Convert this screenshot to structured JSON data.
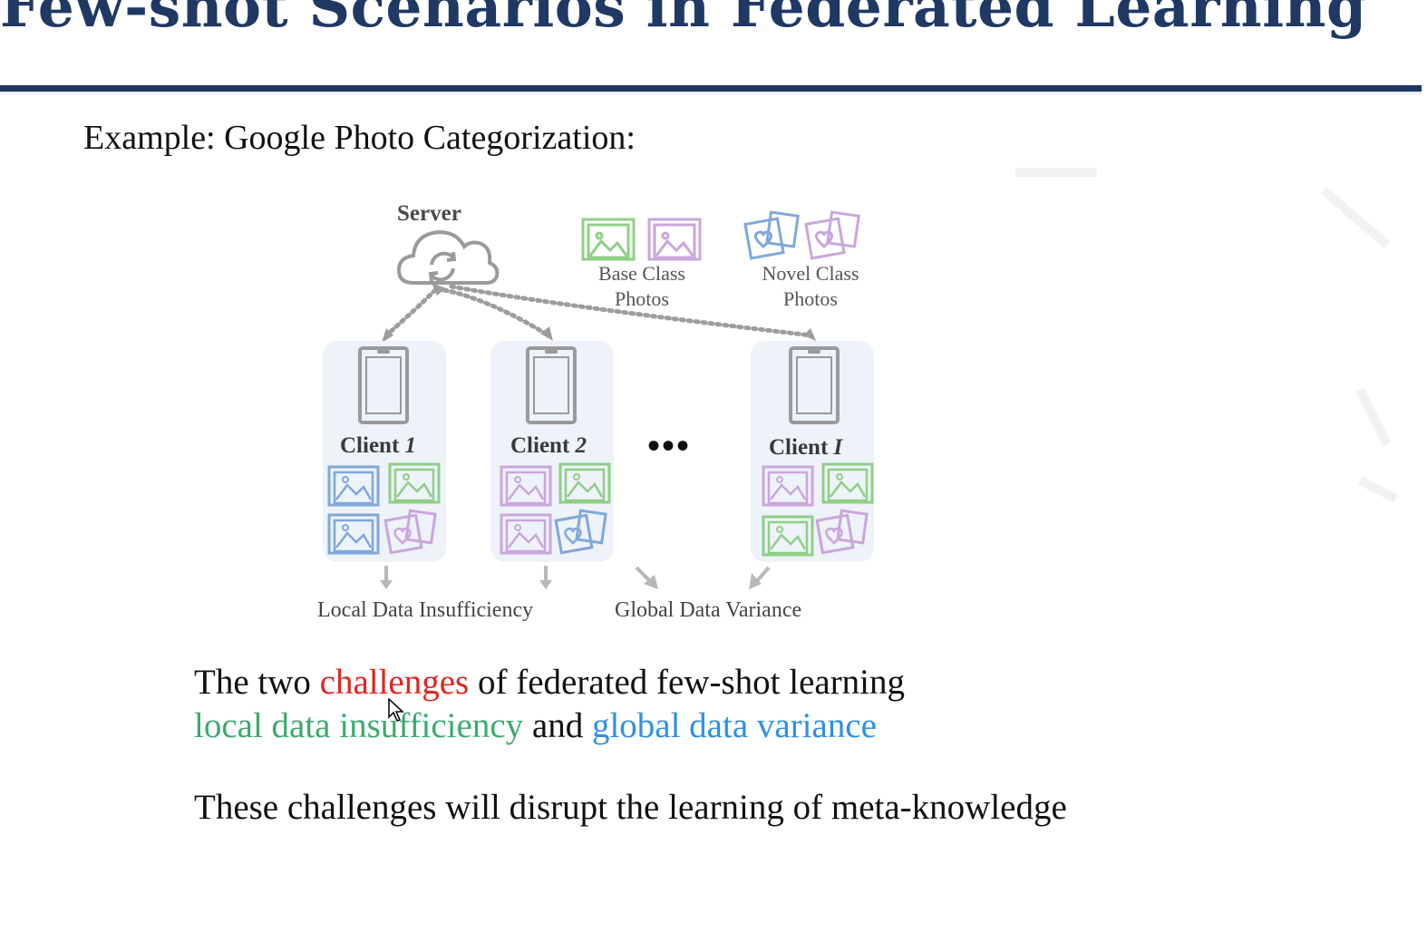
{
  "slide": {
    "title": "Few-shot Scenarios in Federated Learning",
    "subtitle": "Example: Google Photo Categorization:"
  },
  "figure": {
    "server_label": "Server",
    "base_class_line1": "Base Class",
    "base_class_line2": "Photos",
    "novel_class_line1": "Novel Class",
    "novel_class_line2": "Photos",
    "clients": [
      {
        "name": "Client",
        "index": "1"
      },
      {
        "name": "Client",
        "index": "2"
      },
      {
        "name": "Client",
        "index": "I"
      }
    ],
    "ellipsis": "•••",
    "local_label": "Local Data Insufficiency",
    "global_label": "Global Data Variance",
    "colors": {
      "base_green": "#8fcf85",
      "base_purple": "#c9a6dd",
      "novel_blue": "#7fa8d8",
      "card": "#eef2f9",
      "line": "#9a9a9a"
    }
  },
  "text": {
    "line1_pre": "The two ",
    "line1_highlight": "challenges",
    "line1_post": " of federated few-shot learning",
    "line2_green": "local data insufficiency",
    "line2_mid": " and ",
    "line2_blue": "global data variance",
    "line3": "These challenges will disrupt the learning of meta-knowledge"
  },
  "colors": {
    "title": "#1f3864",
    "challenge_red": "#e3241e",
    "local_green": "#3daa6e",
    "global_blue": "#2f8fe6"
  }
}
